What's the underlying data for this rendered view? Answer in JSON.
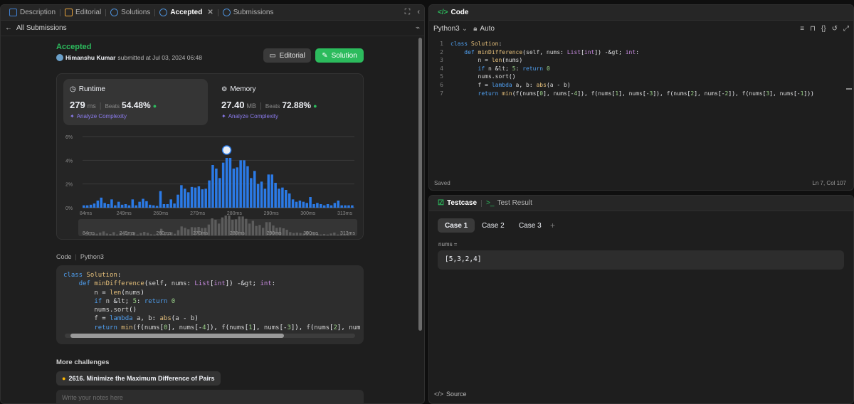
{
  "tabs": [
    {
      "label": "Description"
    },
    {
      "label": "Editorial"
    },
    {
      "label": "Solutions"
    },
    {
      "label": "Accepted"
    },
    {
      "label": "Submissions"
    }
  ],
  "back_label": "All Submissions",
  "submission": {
    "status": "Accepted",
    "user": "Himanshu Kumar",
    "submitted_text": "submitted at Jul 03, 2024 06:48"
  },
  "buttons": {
    "editorial": "Editorial",
    "solution": "Solution"
  },
  "runtime": {
    "title": "Runtime",
    "value": "279",
    "unit": "ms",
    "beats_label": "Beats",
    "beats": "54.48%",
    "analyze": "Analyze Complexity"
  },
  "memory": {
    "title": "Memory",
    "value": "27.40",
    "unit": "MB",
    "beats_label": "Beats",
    "beats": "72.88%",
    "analyze": "Analyze Complexity"
  },
  "chart_data": {
    "type": "bar",
    "ylabels": [
      "6%",
      "4%",
      "2%",
      "0%"
    ],
    "xlabels": [
      "84ms",
      "249ms",
      "260ms",
      "270ms",
      "280ms",
      "290ms",
      "300ms",
      "313ms"
    ],
    "ylim": [
      0,
      6
    ],
    "values": [
      0.2,
      0.2,
      0.25,
      0.35,
      0.6,
      0.85,
      0.4,
      0.3,
      0.7,
      0.2,
      0.5,
      0.25,
      0.3,
      0.2,
      0.7,
      0.2,
      0.5,
      0.75,
      0.55,
      0.25,
      0.2,
      0.15,
      1.4,
      0.3,
      0.3,
      0.7,
      0.35,
      1.1,
      1.9,
      1.6,
      1.3,
      1.75,
      1.7,
      1.8,
      1.55,
      1.6,
      2.3,
      3.6,
      3.3,
      2.5,
      3.8,
      4.2,
      4.2,
      3.3,
      3.4,
      4.0,
      4.0,
      3.5,
      2.5,
      3.1,
      2.0,
      2.2,
      1.6,
      2.8,
      2.8,
      2.1,
      1.6,
      1.7,
      1.5,
      1.2,
      0.7,
      0.5,
      0.6,
      0.5,
      0.4,
      0.9,
      0.3,
      0.4,
      0.3,
      0.2,
      0.3,
      0.2,
      0.4,
      0.6,
      0.2,
      0.2,
      0.2,
      0.2
    ],
    "highlight_index": 41
  },
  "code_header": {
    "label": "Code",
    "lang": "Python3"
  },
  "more_label": "More challenges",
  "challenge": "2616. Minimize the Maximum Difference of Pairs",
  "notes_placeholder": "Write your notes here",
  "editor": {
    "title": "Code",
    "lang": "Python3",
    "mode": "Auto",
    "saved": "Saved",
    "pos": "Ln 7, Col 107"
  },
  "code_lines": [
    "class Solution:",
    "    def minDifference(self, nums: List[int]) -> int:",
    "        n = len(nums)",
    "        if n < 5: return 0",
    "        nums.sort()",
    "        f = lambda a, b: abs(a - b)",
    "        return min(f(nums[0], nums[-4]), f(nums[1], nums[-3]), f(nums[2], nums[-2]), f(nums[3], nums[-1]))"
  ],
  "test": {
    "tab1": "Testcase",
    "tab2": "Test Result",
    "cases": [
      "Case 1",
      "Case 2",
      "Case 3"
    ],
    "var": "nums =",
    "value": "[5,3,2,4]",
    "source": "Source"
  }
}
